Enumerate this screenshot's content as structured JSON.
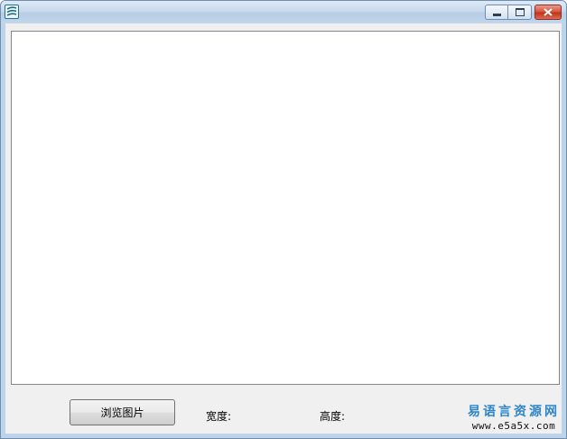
{
  "window": {
    "title": "",
    "icon": "app-logo-icon",
    "controls": {
      "minimize_icon": "minimize-icon",
      "maximize_icon": "maximize-icon",
      "close_icon": "close-icon"
    }
  },
  "toolbar": {
    "browse_label": "浏览图片",
    "width_label": "宽度:",
    "height_label": "高度:"
  },
  "watermark": {
    "text": "易语言资源网",
    "url": "www.e5a5x.com",
    "color": "#2e86c8"
  },
  "colors": {
    "titlebar": "#c7d9ec",
    "client": "#f0f0f0",
    "close_button": "#c4331b"
  }
}
